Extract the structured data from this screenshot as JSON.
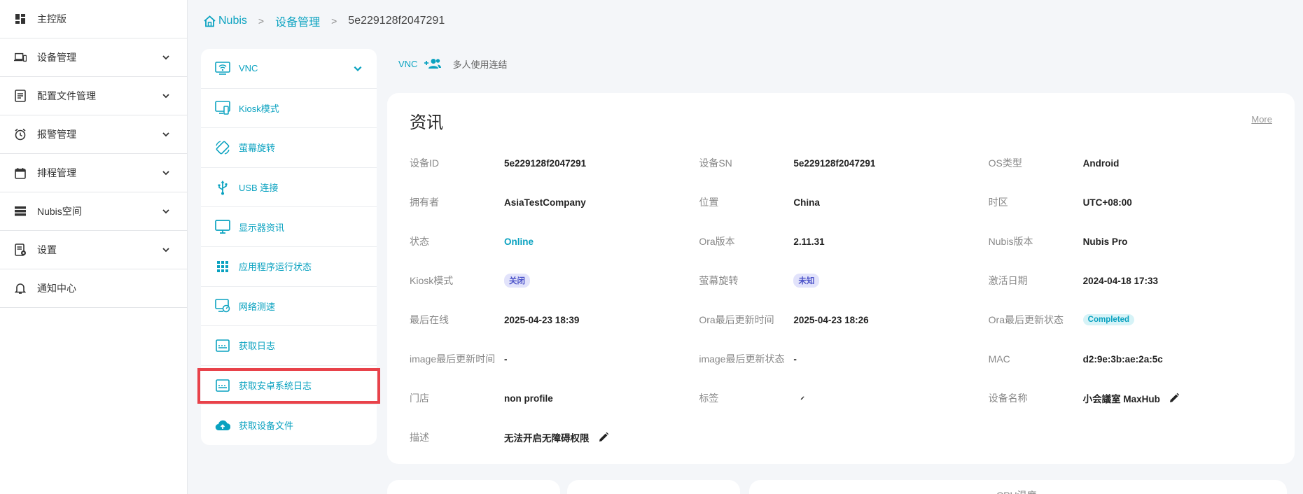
{
  "nav": {
    "items": [
      {
        "label": "主控版",
        "icon": "dashboard-icon",
        "has_chevron": false
      },
      {
        "label": "设备管理",
        "icon": "devices-icon",
        "has_chevron": true
      },
      {
        "label": "配置文件管理",
        "icon": "profile-file-icon",
        "has_chevron": true
      },
      {
        "label": "报警管理",
        "icon": "alarm-clock-icon",
        "has_chevron": true
      },
      {
        "label": "排程管理",
        "icon": "calendar-icon",
        "has_chevron": true
      },
      {
        "label": "Nubis空间",
        "icon": "storage-icon",
        "has_chevron": true
      },
      {
        "label": "设置",
        "icon": "settings-doc-icon",
        "has_chevron": true
      },
      {
        "label": "通知中心",
        "icon": "bell-icon",
        "has_chevron": false
      }
    ]
  },
  "breadcrumb": {
    "home": "Nubis",
    "section": "设备管理",
    "current": "5e229128f2047291"
  },
  "menu": {
    "items": [
      {
        "label": "VNC",
        "icon": "vnc-icon"
      },
      {
        "label": "Kiosk模式",
        "icon": "kiosk-icon"
      },
      {
        "label": "萤幕旋转",
        "icon": "screen-rotation-icon"
      },
      {
        "label": "USB 连接",
        "icon": "usb-icon"
      },
      {
        "label": "显示器资讯",
        "icon": "monitor-icon"
      },
      {
        "label": "应用程序运行状态",
        "icon": "apps-grid-icon"
      },
      {
        "label": "网络测速",
        "icon": "network-speed-icon"
      },
      {
        "label": "获取日志",
        "icon": "log-icon"
      },
      {
        "label": "获取安卓系统日志",
        "icon": "android-log-icon"
      },
      {
        "label": "获取设备文件",
        "icon": "cloud-upload-icon"
      }
    ]
  },
  "tabs": {
    "vnc": "VNC",
    "multi": "多人使用连结"
  },
  "info": {
    "title": "资讯",
    "more": "More",
    "device_id_label": "设备ID",
    "device_id": "5e229128f2047291",
    "device_sn_label": "设备SN",
    "device_sn": "5e229128f2047291",
    "os_label": "OS类型",
    "os": "Android",
    "owner_label": "拥有者",
    "owner": "AsiaTestCompany",
    "location_label": "位置",
    "location": "China",
    "timezone_label": "时区",
    "timezone": "UTC+08:00",
    "status_label": "状态",
    "status": "Online",
    "ora_ver_label": "Ora版本",
    "ora_ver": "2.11.31",
    "nubis_ver_label": "Nubis版本",
    "nubis_ver": "Nubis Pro",
    "kiosk_label": "Kiosk模式",
    "kiosk": "关闭",
    "rotation_label": "萤幕旋转",
    "rotation": "未知",
    "activation_label": "激活日期",
    "activation": "2024-04-18 17:33",
    "last_online_label": "最后在线",
    "last_online": "2025-04-23 18:39",
    "ora_update_time_label": "Ora最后更新时间",
    "ora_update_time": "2025-04-23 18:26",
    "ora_update_status_label": "Ora最后更新状态",
    "ora_update_status": "Completed",
    "image_update_time_label": "image最后更新时间",
    "image_update_time": "-",
    "image_update_status_label": "image最后更新状态",
    "image_update_status": "-",
    "mac_label": "MAC",
    "mac": "d2:9e:3b:ae:2a:5c",
    "store_label": "门店",
    "store": "non profile",
    "tags_label": "标签",
    "device_name_label": "设备名称",
    "device_name": "小会議室 MaxHub",
    "desc_label": "描述",
    "desc": "无法开启无障碍权限"
  },
  "bottom": {
    "cpu_label": "CPU温度"
  },
  "colors": {
    "accent": "#0aa2c0",
    "highlight": "#e8424a",
    "badge_purple_bg": "#e2e3fb",
    "badge_purple_text": "#4b52c8",
    "badge_cyan_bg": "#d6f3f7"
  }
}
